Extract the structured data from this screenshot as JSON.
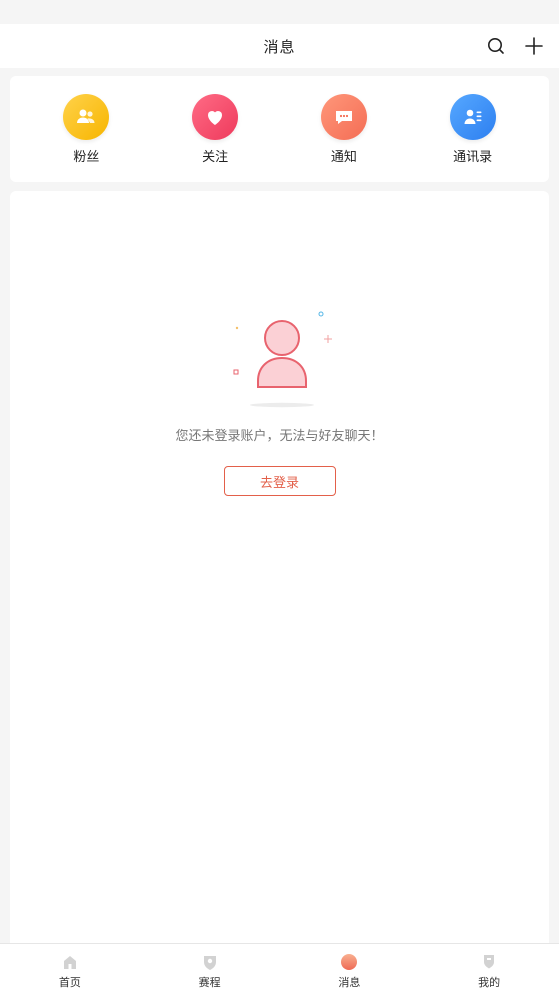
{
  "header": {
    "title": "消息",
    "icons": [
      "search-icon",
      "plus-icon"
    ]
  },
  "quick_actions": [
    {
      "label": "粉丝",
      "icon": "fans-icon",
      "color": "#f7b500"
    },
    {
      "label": "关注",
      "icon": "heart-icon",
      "color": "#ee3a5c"
    },
    {
      "label": "通知",
      "icon": "notice-icon",
      "color": "#f46d55"
    },
    {
      "label": "通讯录",
      "icon": "contacts-icon",
      "color": "#2d7ff0"
    }
  ],
  "empty_state": {
    "illustration": "user-placeholder-icon",
    "message": "您还未登录账户，无法与好友聊天！",
    "login_button": "去登录"
  },
  "tabbar": {
    "items": [
      {
        "label": "首页",
        "icon": "home-icon",
        "active": false
      },
      {
        "label": "赛程",
        "icon": "schedule-icon",
        "active": false
      },
      {
        "label": "消息",
        "icon": "message-icon",
        "active": true
      },
      {
        "label": "我的",
        "icon": "profile-icon",
        "active": false
      }
    ]
  },
  "colors": {
    "accent": "#e3604a",
    "background": "#f5f5f5"
  }
}
